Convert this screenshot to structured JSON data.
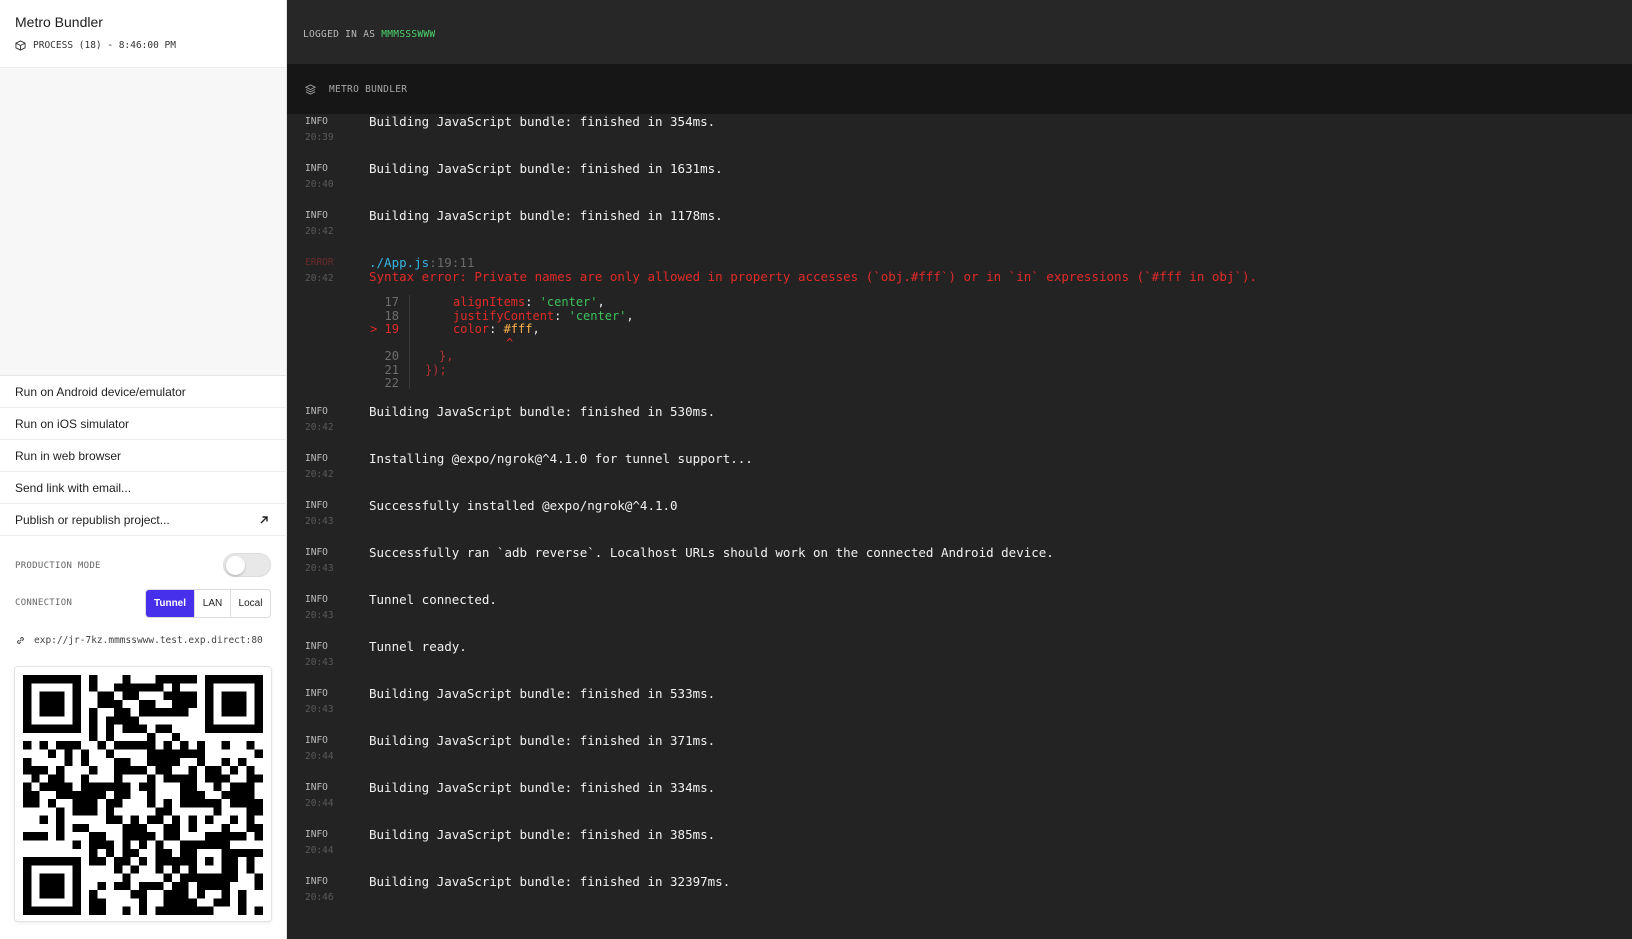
{
  "sidebar": {
    "app_title": "Metro Bundler",
    "process_label": "PROCESS (18) - 8:46:00 PM",
    "actions": [
      {
        "label": "Run on Android device/emulator"
      },
      {
        "label": "Run on iOS simulator"
      },
      {
        "label": "Run in web browser"
      },
      {
        "label": "Send link with email..."
      },
      {
        "label": "Publish or republish project..."
      }
    ],
    "production_mode_label": "PRODUCTION MODE",
    "production_mode_on": false,
    "connection_label": "CONNECTION",
    "connection_options": [
      "Tunnel",
      "LAN",
      "Local"
    ],
    "connection_selected": "Tunnel",
    "url": "exp://jr-7kz.mmmsswww.test.exp.direct:80",
    "qr_alt": "qr-code"
  },
  "topbar": {
    "login_prefix": "LOGGED IN AS",
    "username": "MMMSSSWWW"
  },
  "panel": {
    "title": "METRO BUNDLER"
  },
  "logs": [
    {
      "level": "INFO",
      "time": "20:39",
      "message": "Building JavaScript bundle: finished in 354ms."
    },
    {
      "level": "INFO",
      "time": "20:40",
      "message": "Building JavaScript bundle: finished in 1631ms."
    },
    {
      "level": "INFO",
      "time": "20:42",
      "message": "Building JavaScript bundle: finished in 1178ms."
    },
    {
      "level": "ERROR",
      "time": "20:42",
      "file": "./App.js",
      "location": ":19:11",
      "message": "Syntax error: Private names are only allowed in property accesses (`obj.#fff`) or in `in` expressions (`#fff in obj`).",
      "code_frame": {
        "line_numbers": [
          "17",
          "18",
          "> 19",
          "",
          "20",
          "21",
          "22"
        ],
        "lines": [
          {
            "prop": "alignItems",
            "value": "'center'"
          },
          {
            "prop": "justifyContent",
            "value": "'center'"
          },
          {
            "prop": "color",
            "value": "#fff"
          },
          {
            "caret": "^"
          },
          {
            "text": "},"
          },
          {
            "text": "});"
          },
          {
            "text": ""
          }
        ]
      }
    },
    {
      "level": "INFO",
      "time": "20:42",
      "message": "Building JavaScript bundle: finished in 530ms."
    },
    {
      "level": "INFO",
      "time": "20:42",
      "message": "Installing @expo/ngrok@^4.1.0 for tunnel support..."
    },
    {
      "level": "INFO",
      "time": "20:43",
      "message": "Successfully installed @expo/ngrok@^4.1.0"
    },
    {
      "level": "INFO",
      "time": "20:43",
      "message": "Successfully ran `adb reverse`. Localhost URLs should work on the connected Android device."
    },
    {
      "level": "INFO",
      "time": "20:43",
      "message": "Tunnel connected."
    },
    {
      "level": "INFO",
      "time": "20:43",
      "message": "Tunnel ready."
    },
    {
      "level": "INFO",
      "time": "20:43",
      "message": "Building JavaScript bundle: finished in 533ms."
    },
    {
      "level": "INFO",
      "time": "20:44",
      "message": "Building JavaScript bundle: finished in 371ms."
    },
    {
      "level": "INFO",
      "time": "20:44",
      "message": "Building JavaScript bundle: finished in 334ms."
    },
    {
      "level": "INFO",
      "time": "20:44",
      "message": "Building JavaScript bundle: finished in 385ms."
    },
    {
      "level": "INFO",
      "time": "20:46",
      "message": "Building JavaScript bundle: finished in 32397ms."
    }
  ],
  "colors": {
    "accent": "#4630eb",
    "username": "#4ad66d",
    "error": "#e22a2a",
    "file_link": "#36b3e0",
    "string": "#3cc25b"
  },
  "icons": {
    "process": "cube-icon",
    "publish_arrow": "arrow-up-right-icon",
    "url": "link-icon",
    "panel": "layers-icon"
  }
}
